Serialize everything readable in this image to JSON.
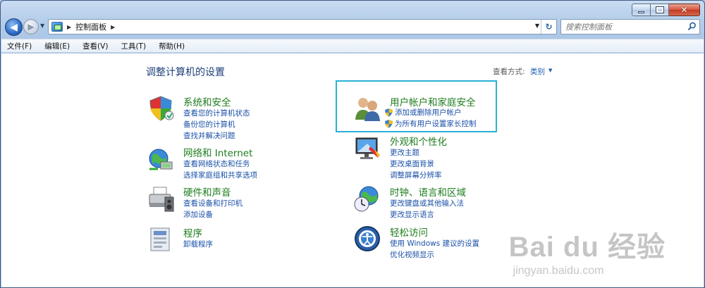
{
  "window": {
    "caption": {
      "min": "–",
      "max": "□",
      "close": "✕"
    }
  },
  "nav": {
    "back": "◀",
    "forward": "▶",
    "breadcrumb": [
      "控制面板"
    ],
    "search_placeholder": "搜索控制面板"
  },
  "menu": [
    "文件(F)",
    "编辑(E)",
    "查看(V)",
    "工具(T)",
    "帮助(H)"
  ],
  "content": {
    "page_title": "调整计算机的设置",
    "view_by_label": "查看方式:",
    "view_by_value": "类别",
    "categories": [
      {
        "title": "系统和安全",
        "icon": "shield-icon",
        "links": [
          "查看您的计算机状态",
          "备份您的计算机",
          "查找并解决问题"
        ]
      },
      {
        "title": "网络和 Internet",
        "icon": "network-globe-icon",
        "links": [
          "查看网络状态和任务",
          "选择家庭组和共享选项"
        ]
      },
      {
        "title": "硬件和声音",
        "icon": "printer-icon",
        "links": [
          "查看设备和打印机",
          "添加设备"
        ]
      },
      {
        "title": "程序",
        "icon": "programs-icon",
        "links": [
          "卸载程序"
        ]
      },
      {
        "title": "用户帐户和家庭安全",
        "icon": "users-icon",
        "links": [
          "添加或删除用户帐户",
          "为所有用户设置家长控制"
        ]
      },
      {
        "title": "外观和个性化",
        "icon": "monitor-icon",
        "links": [
          "更改主题",
          "更改桌面背景",
          "调整屏幕分辨率"
        ]
      },
      {
        "title": "时钟、语言和区域",
        "icon": "clock-globe-icon",
        "links": [
          "更改键盘或其他输入法",
          "更改显示语言"
        ]
      },
      {
        "title": "轻松访问",
        "icon": "ease-of-access-icon",
        "links": [
          "使用 Windows 建议的设置",
          "优化视频显示"
        ]
      }
    ]
  },
  "watermark": {
    "logo": "Bai du 经验",
    "url": "jingyan.baidu.com"
  },
  "colors": {
    "category_title": "#1e7d1e",
    "link": "#1a50a8",
    "highlight": "#2ab0d7"
  }
}
